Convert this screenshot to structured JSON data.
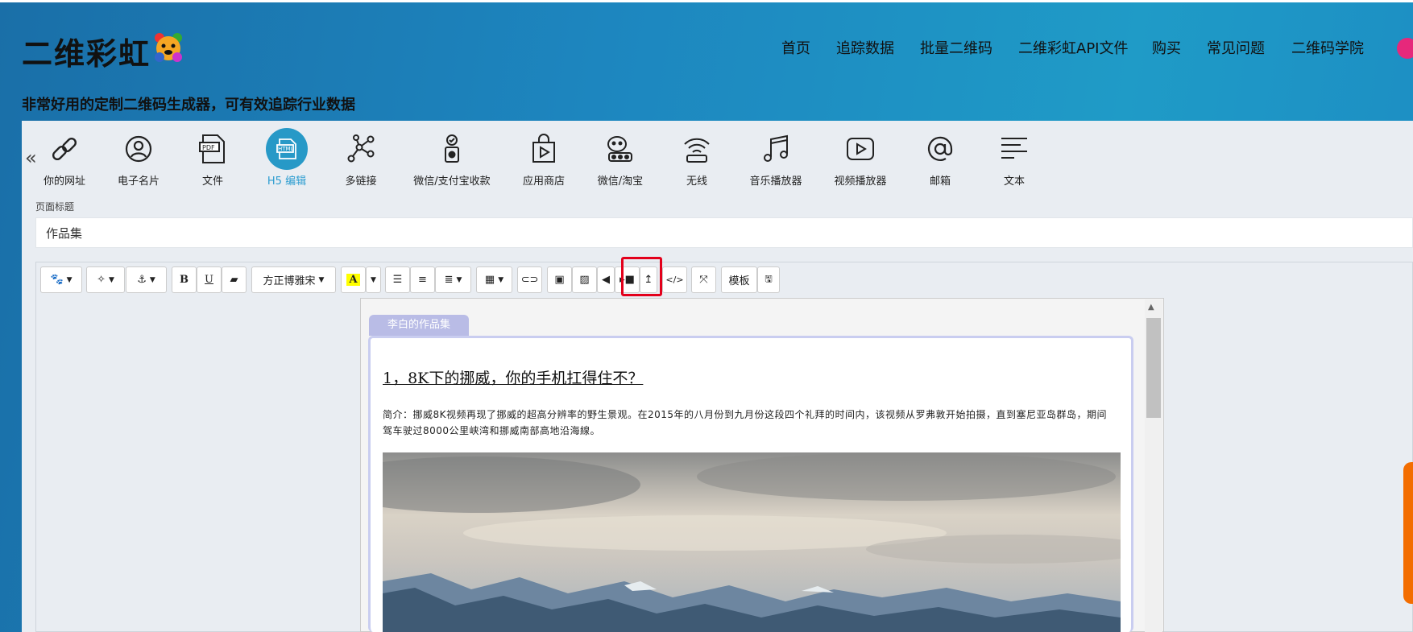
{
  "header": {
    "logo_text": "二维彩虹",
    "slogan": "非常好用的定制二维码生成器，可有效追踪行业数据"
  },
  "nav": [
    "首页",
    "追踪数据",
    "批量二维码",
    "二维彩虹API文件",
    "购买",
    "常见问题",
    "二维码学院"
  ],
  "types": [
    {
      "label": "你的网址",
      "icon": "link-icon"
    },
    {
      "label": "电子名片",
      "icon": "person-icon"
    },
    {
      "label": "文件",
      "icon": "pdf-icon"
    },
    {
      "label": "H5 编辑",
      "icon": "html-icon",
      "active": true
    },
    {
      "label": "多链接",
      "icon": "network-icon"
    },
    {
      "label": "微信/支付宝收款",
      "icon": "payment-icon"
    },
    {
      "label": "应用商店",
      "icon": "shopping-bag-icon"
    },
    {
      "label": "微信/淘宝",
      "icon": "wechat-icon"
    },
    {
      "label": "无线",
      "icon": "wifi-icon"
    },
    {
      "label": "音乐播放器",
      "icon": "music-icon"
    },
    {
      "label": "视频播放器",
      "icon": "video-icon"
    },
    {
      "label": "邮箱",
      "icon": "at-icon"
    },
    {
      "label": "文本",
      "icon": "text-lines-icon"
    }
  ],
  "form": {
    "title_label": "页面标题",
    "title_value": "作品集"
  },
  "toolbar": {
    "font_name": "方正博雅宋",
    "template_label": "模板"
  },
  "document": {
    "tab_label": "李白的作品集",
    "article_title": "1，8K下的挪威，你的手机扛得住不？",
    "article_desc": "简介：挪威8K视频再现了挪威的超高分辨率的野生景观。在2015年的八月份到九月份这段四个礼拜的时间内，该视频从罗弗敦开始拍摄，直到塞尼亚岛群岛，期间驾车驶过8000公里峡湾和挪威南部高地沿海線。"
  },
  "colors": {
    "accent": "#2799c7",
    "highlight": "#e3001b",
    "tab": "#b9bce6"
  }
}
